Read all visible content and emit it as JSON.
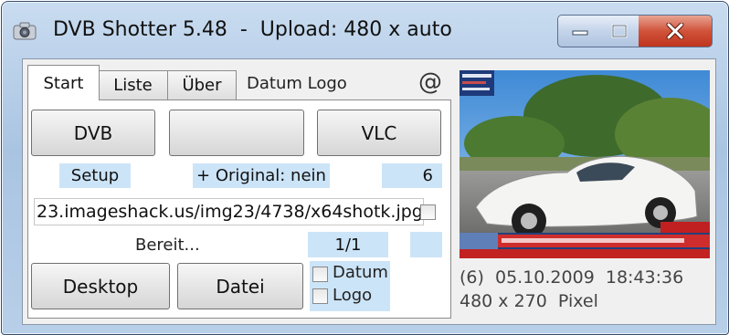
{
  "window": {
    "title": "DVB Shotter 5.48  -  Upload: 480 x auto"
  },
  "tabs": [
    {
      "label": "Start",
      "selected": true
    },
    {
      "label": "Liste",
      "selected": false
    },
    {
      "label": "Über",
      "selected": false
    }
  ],
  "extra_labels": {
    "datum_logo": "Datum Logo",
    "at_symbol": "@"
  },
  "buttons": {
    "dvb": "DVB",
    "blank": "",
    "vlc": "VLC",
    "desktop": "Desktop",
    "datei": "Datei"
  },
  "labels": {
    "setup": "Setup",
    "original": "+ Original: nein",
    "count": "6",
    "status": "Bereit...",
    "page": "1/1",
    "empty_box": ""
  },
  "url_field": {
    "value": "23.imageshack.us/img23/4738/x64shotk.jpg",
    "checked": false
  },
  "options": [
    {
      "label": "Datum",
      "checked": false
    },
    {
      "label": "Logo",
      "checked": false
    }
  ],
  "preview": {
    "ticker_text": "",
    "info_line1": "(6)  05.10.2009  18:43:36",
    "info_line2": "480 x 270  Pixel"
  },
  "colors": {
    "label_blue": "#cce4f7",
    "close_red": "#c8412a",
    "titlebar_blue": "#b4cce6"
  }
}
